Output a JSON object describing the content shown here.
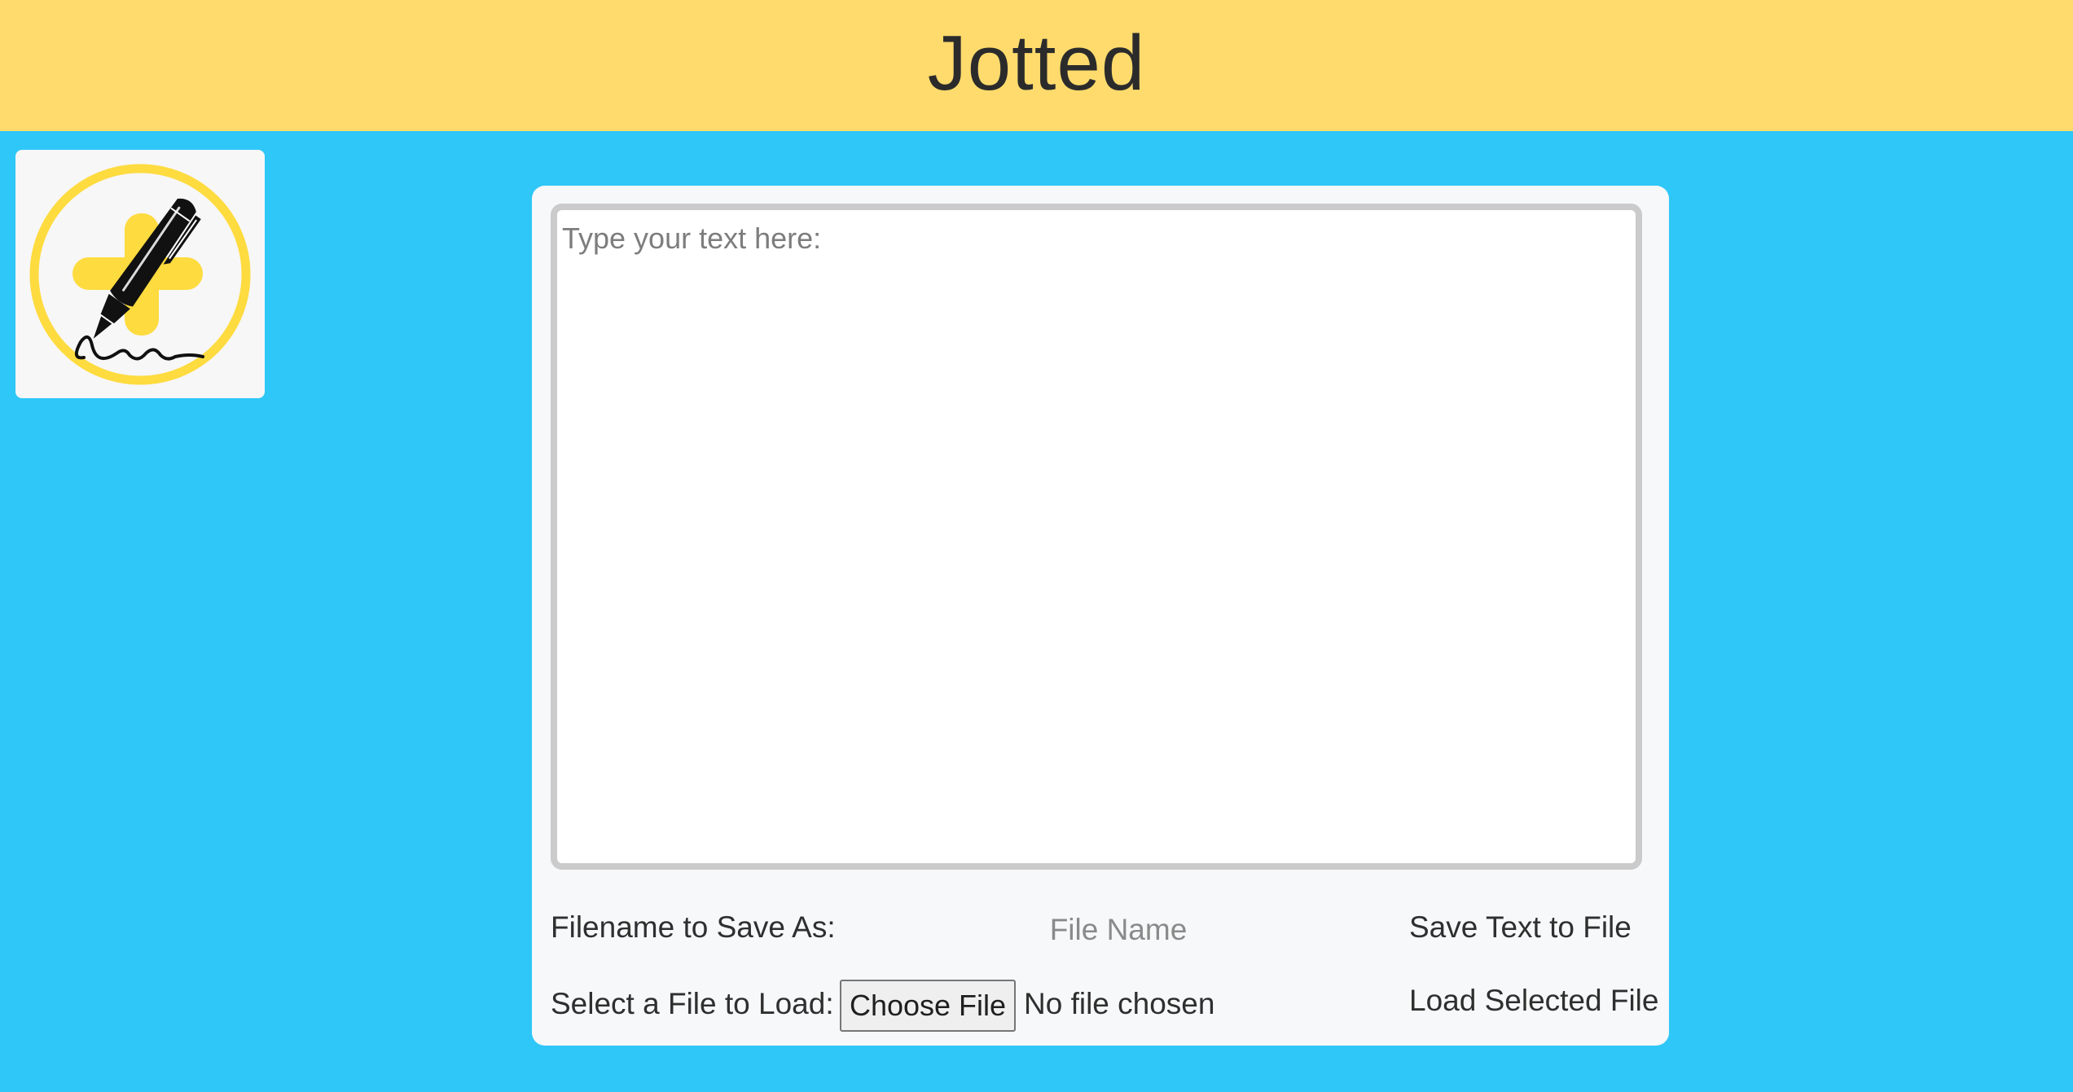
{
  "header": {
    "title": "Jotted",
    "background_color": "#fedb6c"
  },
  "logo": {
    "icon": "pen-with-plus-logo-icon",
    "accent_color": "#fedb3f"
  },
  "editor": {
    "placeholder": "Type your text here:",
    "value": ""
  },
  "save_row": {
    "label": "Filename to Save As:",
    "input_placeholder": "File Name",
    "input_value": "",
    "button_label": "Save Text to File"
  },
  "load_row": {
    "label": "Select a File to Load:",
    "choose_button_label": "Choose File",
    "file_status": "No file chosen",
    "button_label": "Load Selected File"
  },
  "theme": {
    "page_background": "#2ec7f7",
    "card_background": "#f7f8f9"
  }
}
